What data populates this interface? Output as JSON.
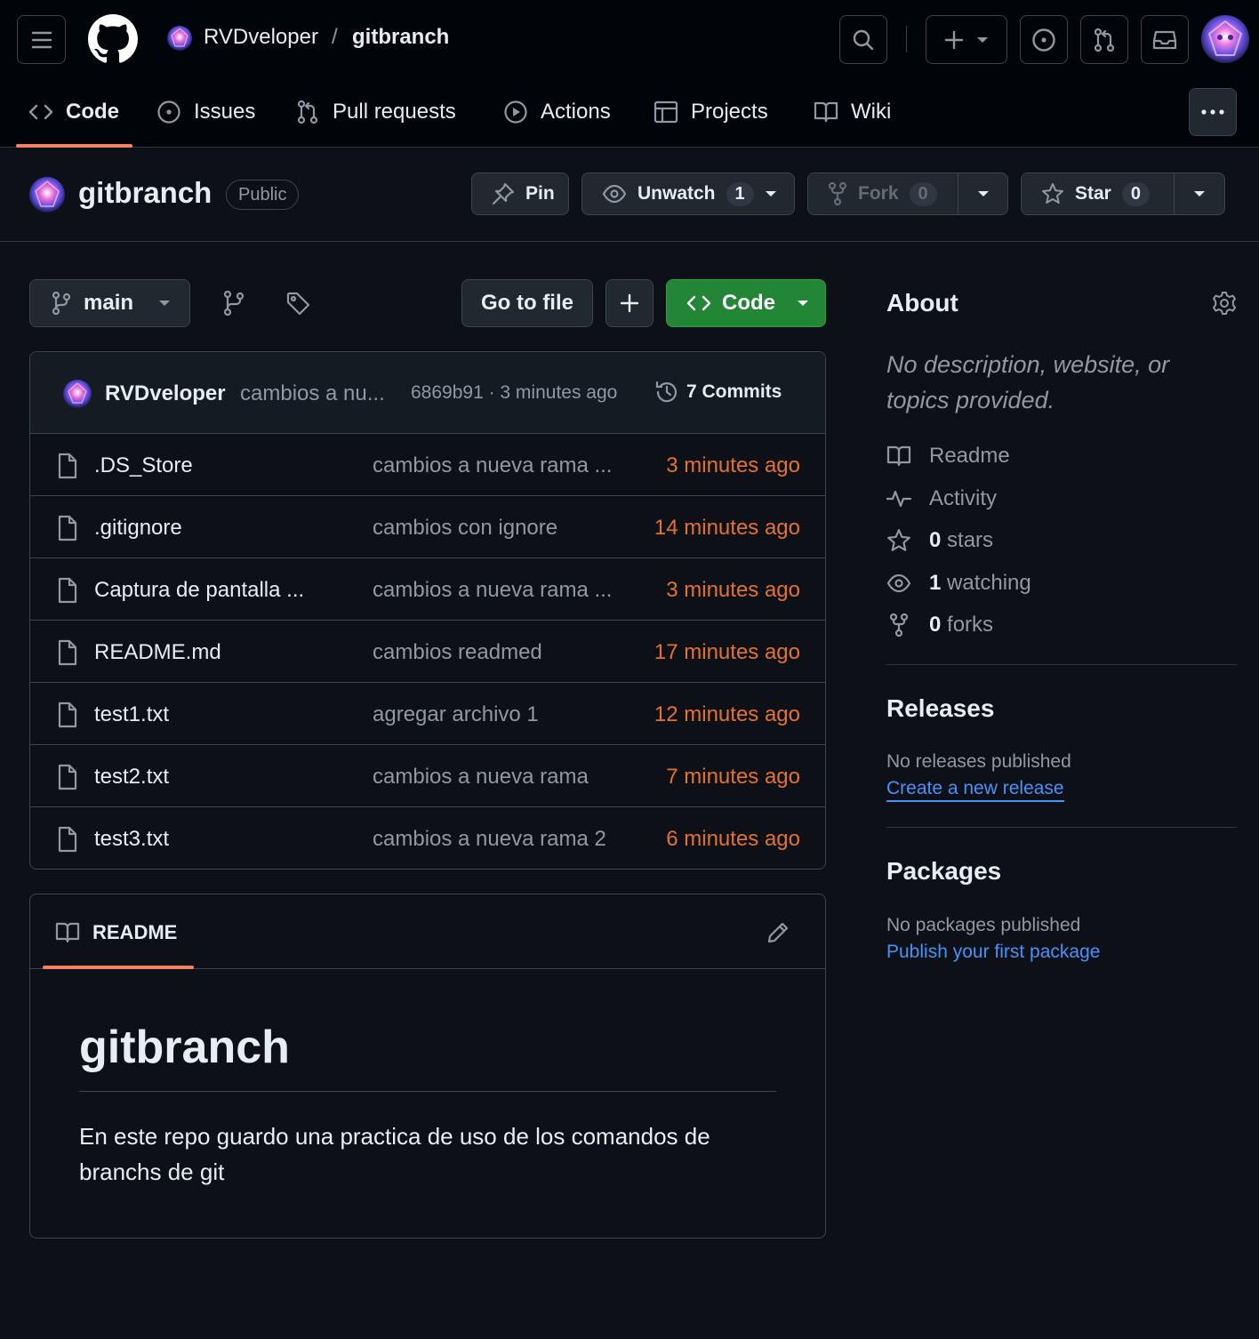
{
  "header": {
    "owner": "RVDveloper",
    "separator": "/",
    "repo": "gitbranch"
  },
  "nav": {
    "tabs": [
      {
        "label": "Code",
        "icon": "code-icon",
        "active": true
      },
      {
        "label": "Issues",
        "icon": "issue-icon"
      },
      {
        "label": "Pull requests",
        "icon": "pull-request-icon"
      },
      {
        "label": "Actions",
        "icon": "play-icon"
      },
      {
        "label": "Projects",
        "icon": "table-icon"
      },
      {
        "label": "Wiki",
        "icon": "book-icon"
      }
    ]
  },
  "repo": {
    "name": "gitbranch",
    "visibility": "Public",
    "pin_label": "Pin",
    "unwatch_label": "Unwatch",
    "watch_count": "1",
    "fork_label": "Fork",
    "fork_count": "0",
    "star_label": "Star",
    "star_count": "0"
  },
  "toolbar": {
    "branch": "main",
    "go_to_file": "Go to file",
    "code_button": "Code"
  },
  "latest_commit": {
    "author": "RVDveloper",
    "message": "cambios a nu...",
    "hash_time": "6869b91 · 3 minutes ago",
    "commits_label": "7 Commits"
  },
  "files": [
    {
      "name": ".DS_Store",
      "message": "cambios a nueva rama ...",
      "age": "3 minutes ago"
    },
    {
      "name": ".gitignore",
      "message": "cambios con ignore",
      "age": "14 minutes ago"
    },
    {
      "name": "Captura de pantalla ...",
      "message": "cambios a nueva rama ...",
      "age": "3 minutes ago"
    },
    {
      "name": "README.md",
      "message": "cambios readmed",
      "age": "17 minutes ago"
    },
    {
      "name": "test1.txt",
      "message": "agregar archivo 1",
      "age": "12 minutes ago"
    },
    {
      "name": "test2.txt",
      "message": "cambios a nueva rama",
      "age": "7 minutes ago"
    },
    {
      "name": "test3.txt",
      "message": "cambios a nueva rama 2",
      "age": "6 minutes ago"
    }
  ],
  "readme": {
    "tab_label": "README",
    "heading": "gitbranch",
    "body": "En este repo guardo una practica de uso de los comandos de branchs de git"
  },
  "about": {
    "title": "About",
    "description": "No description, website, or topics provided.",
    "items": [
      {
        "icon": "book-icon",
        "count": "",
        "label": "Readme"
      },
      {
        "icon": "pulse-icon",
        "count": "",
        "label": "Activity"
      },
      {
        "icon": "star-icon",
        "count": "0",
        "label": " stars"
      },
      {
        "icon": "eye-icon",
        "count": "1",
        "label": " watching"
      },
      {
        "icon": "fork-icon",
        "count": "0",
        "label": " forks"
      }
    ]
  },
  "releases": {
    "title": "Releases",
    "status": "No releases published",
    "link": "Create a new release"
  },
  "packages": {
    "title": "Packages",
    "status": "No packages published",
    "link": "Publish your first package"
  },
  "colors": {
    "background": "#0d1117",
    "header": "#010409",
    "accent_underline": "#f78166",
    "age_text": "#e3722d",
    "link": "#4493f8",
    "code_button": "#238636"
  }
}
